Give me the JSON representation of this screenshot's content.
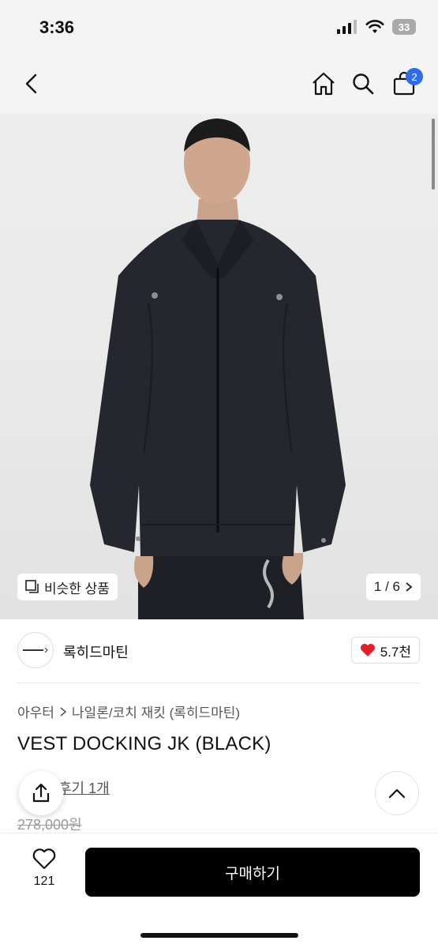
{
  "status_bar": {
    "time": "3:36",
    "battery": "33"
  },
  "nav": {
    "cart_count": "2"
  },
  "hero": {
    "similar_label": "비슷한 상품",
    "pagination": "1 / 6"
  },
  "shop": {
    "name": "록히드마틴",
    "likes": "5.7천"
  },
  "product": {
    "breadcrumb": [
      "아우터",
      "나일론/코치 재킷 (록히드마틴)"
    ],
    "title": "VEST DOCKING JK (BLACK)",
    "review_link": "후기 1개",
    "original_price": "278,000원"
  },
  "bottom": {
    "wish_count": "121",
    "buy_label": "구매하기"
  },
  "colors": {
    "accent": "#2f6bea",
    "heart": "#e0202a",
    "buy": "#000000"
  }
}
